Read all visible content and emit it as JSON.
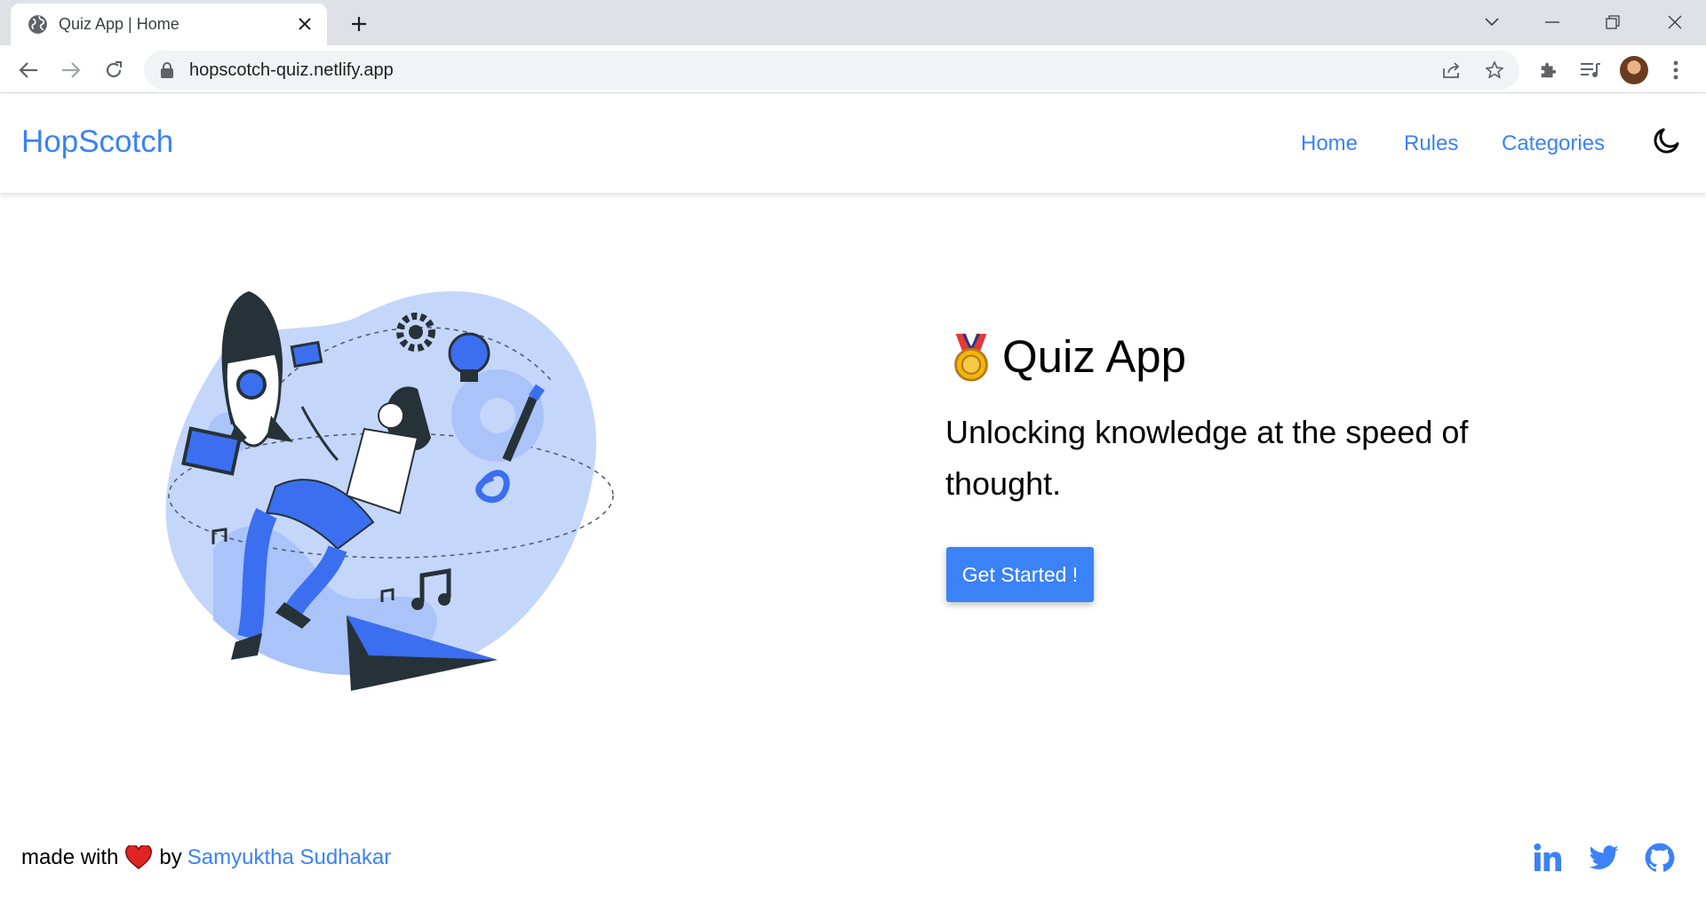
{
  "browser": {
    "tab_title": "Quiz App | Home",
    "url": "hopscotch-quiz.netlify.app"
  },
  "navbar": {
    "brand": "HopScotch",
    "links": [
      {
        "label": "Home"
      },
      {
        "label": "Rules"
      },
      {
        "label": "Categories"
      }
    ],
    "theme_icon": "moon-icon"
  },
  "hero": {
    "title": "Quiz App",
    "title_icon": "medal-icon",
    "subtitle": "Unlocking knowledge at the speed of thought.",
    "cta_label": "Get Started !",
    "illustration": "woman-floating-with-rocket-illustration"
  },
  "footer": {
    "made_with": "made with",
    "by": "by",
    "author": "Samyuktha Sudhakar",
    "social": [
      {
        "icon": "linkedin-icon"
      },
      {
        "icon": "twitter-icon"
      },
      {
        "icon": "github-icon"
      }
    ]
  },
  "colors": {
    "accent": "#3b82f6",
    "illustration_light": "#c5d6fb",
    "illustration_dark": "#263238"
  }
}
